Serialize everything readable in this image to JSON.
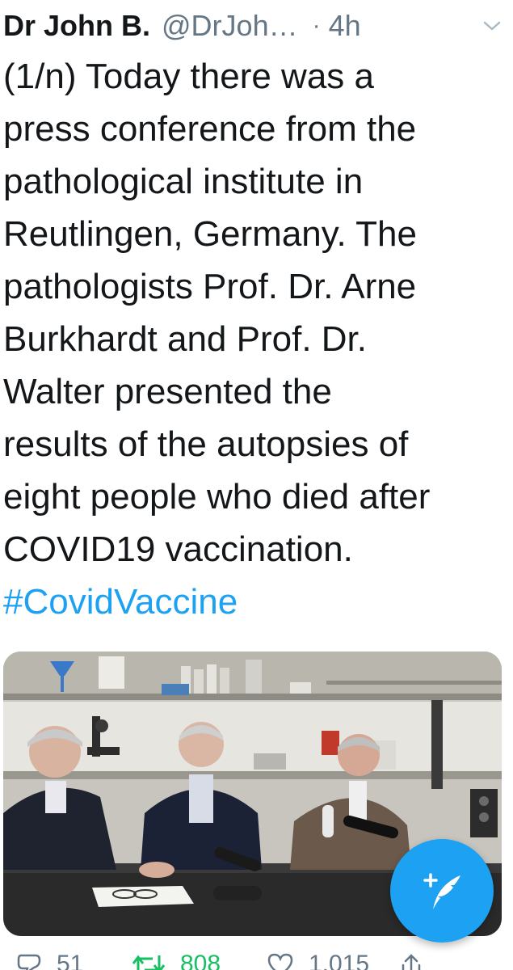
{
  "tweet": {
    "display_name": "Dr John B.",
    "handle": "@DrJoh…",
    "separator": "·",
    "time": "4h",
    "body_lines": [
      "(1/n) Today there was a",
      "press conference from the",
      "pathological institute in",
      "Reutlingen, Germany. The",
      "pathologists Prof. Dr. Arne",
      "Burkhardt and Prof. Dr.",
      "Walter presented the",
      "results of the autopsies of",
      "eight people who died after",
      "COVID19 vaccination."
    ],
    "hashtag": "#CovidVaccine"
  },
  "actions": {
    "replies": "51",
    "retweets": "808",
    "likes": "1,015"
  },
  "icons": {
    "more": "chevron-down-icon",
    "compose": "compose-tweet-icon",
    "reply": "reply-icon",
    "retweet": "retweet-icon",
    "like": "heart-icon",
    "share": "share-icon"
  },
  "colors": {
    "accent": "#1da1f2",
    "text": "#14171a",
    "muted": "#657786",
    "retweet": "#17bf63"
  }
}
